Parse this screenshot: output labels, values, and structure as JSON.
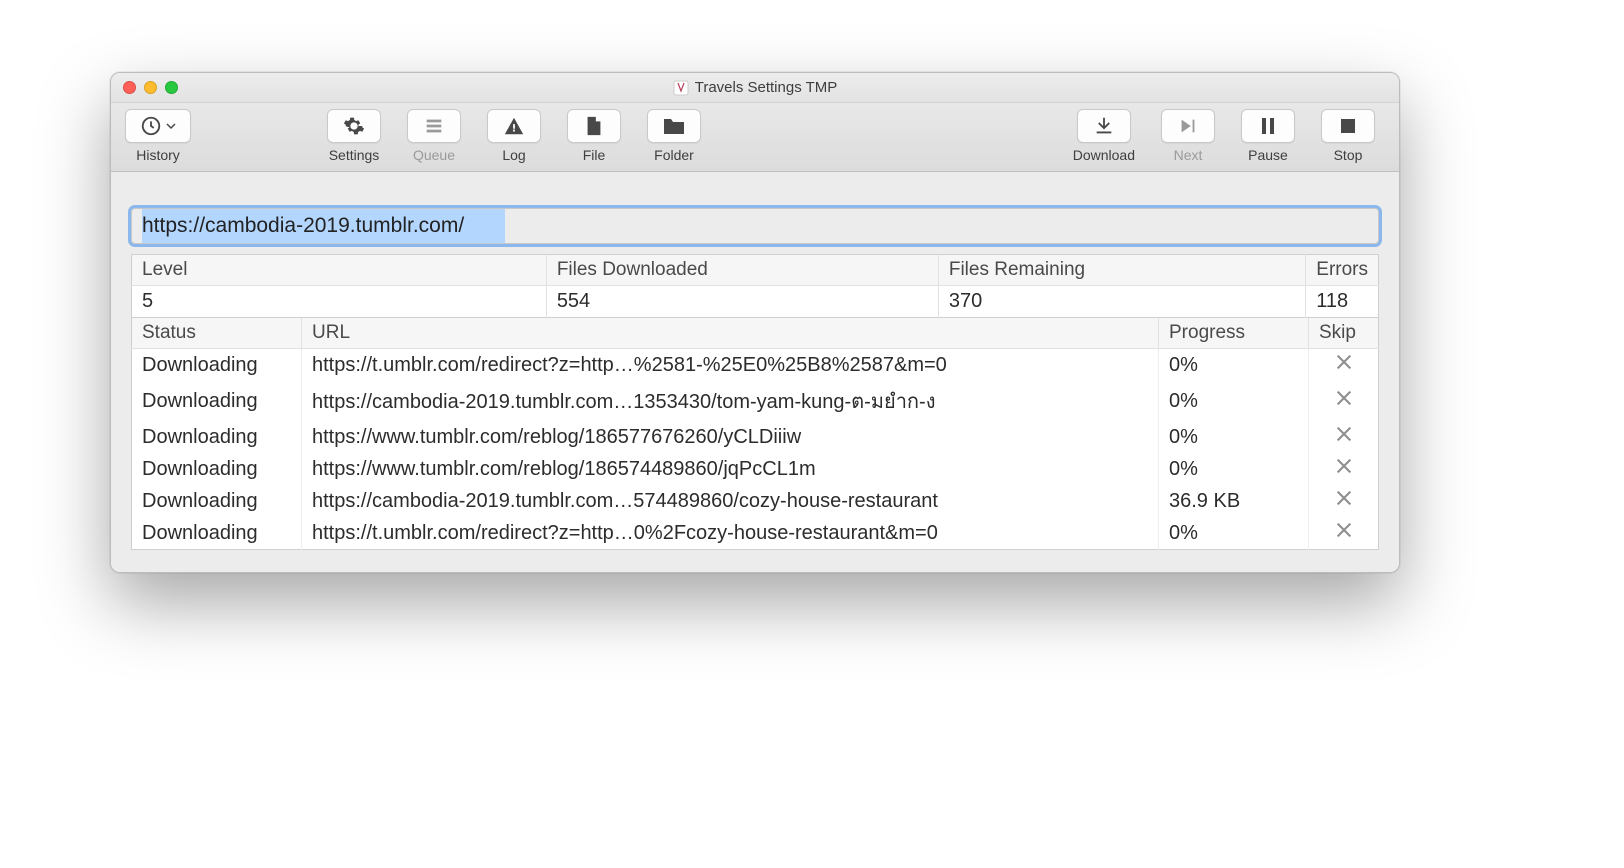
{
  "window": {
    "title": "Travels Settings TMP"
  },
  "toolbar": {
    "history": "History",
    "settings": "Settings",
    "queue": "Queue",
    "log": "Log",
    "file": "File",
    "folder": "Folder",
    "download": "Download",
    "next": "Next",
    "pause": "Pause",
    "stop": "Stop"
  },
  "url": "https://cambodia-2019.tumblr.com/",
  "stats": {
    "headers": {
      "level": "Level",
      "downloaded": "Files Downloaded",
      "remaining": "Files Remaining",
      "errors": "Errors"
    },
    "level": "5",
    "downloaded": "554",
    "remaining": "370",
    "errors": "118"
  },
  "downloads": {
    "headers": {
      "status": "Status",
      "url": "URL",
      "progress": "Progress",
      "skip": "Skip"
    },
    "rows": [
      {
        "status": "Downloading",
        "url": "https://t.umblr.com/redirect?z=http…%2581-%25E0%25B8%2587&m=0",
        "progress": "0%"
      },
      {
        "status": "Downloading",
        "url": "https://cambodia-2019.tumblr.com…1353430/tom-yam-kung-ต-มยำก-ง",
        "progress": "0%"
      },
      {
        "status": "Downloading",
        "url": "https://www.tumblr.com/reblog/186577676260/yCLDiiiw",
        "progress": "0%"
      },
      {
        "status": "Downloading",
        "url": "https://www.tumblr.com/reblog/186574489860/jqPcCL1m",
        "progress": "0%"
      },
      {
        "status": "Downloading",
        "url": "https://cambodia-2019.tumblr.com…574489860/cozy-house-restaurant",
        "progress": "36.9 KB"
      },
      {
        "status": "Downloading",
        "url": "https://t.umblr.com/redirect?z=http…0%2Fcozy-house-restaurant&m=0",
        "progress": "0%"
      }
    ]
  }
}
